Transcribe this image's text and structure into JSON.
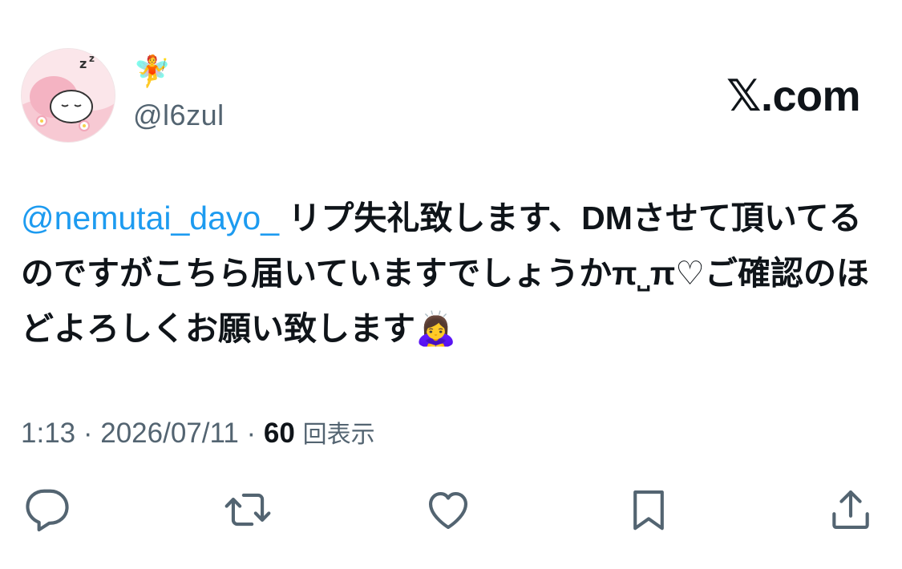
{
  "author": {
    "name_emoji": "🧚",
    "handle": "@l6zul",
    "avatar_icon": "sleeping-character-avatar"
  },
  "brand": {
    "label": "𝕏.com"
  },
  "tweet": {
    "mention": "@nemutai_dayo_",
    "body": " リプ失礼致します、DMさせて頂いてるのですがこちら届いていますでしょうかπ˽π♡ご確認のほどよろしくお願い致します🙇‍♀️"
  },
  "meta": {
    "time": "1:13",
    "separator": " · ",
    "date": "2026/07/11",
    "views_count": "60",
    "views_label": "回表示"
  },
  "actions": [
    {
      "name": "reply",
      "icon": "reply-icon"
    },
    {
      "name": "retweet",
      "icon": "retweet-icon"
    },
    {
      "name": "like",
      "icon": "heart-icon"
    },
    {
      "name": "bookmark",
      "icon": "bookmark-icon"
    },
    {
      "name": "share",
      "icon": "share-icon"
    }
  ],
  "colors": {
    "mention": "#1d9bf0",
    "secondary_text": "#536471",
    "primary_text": "#0f1419",
    "icon": "#536471"
  }
}
